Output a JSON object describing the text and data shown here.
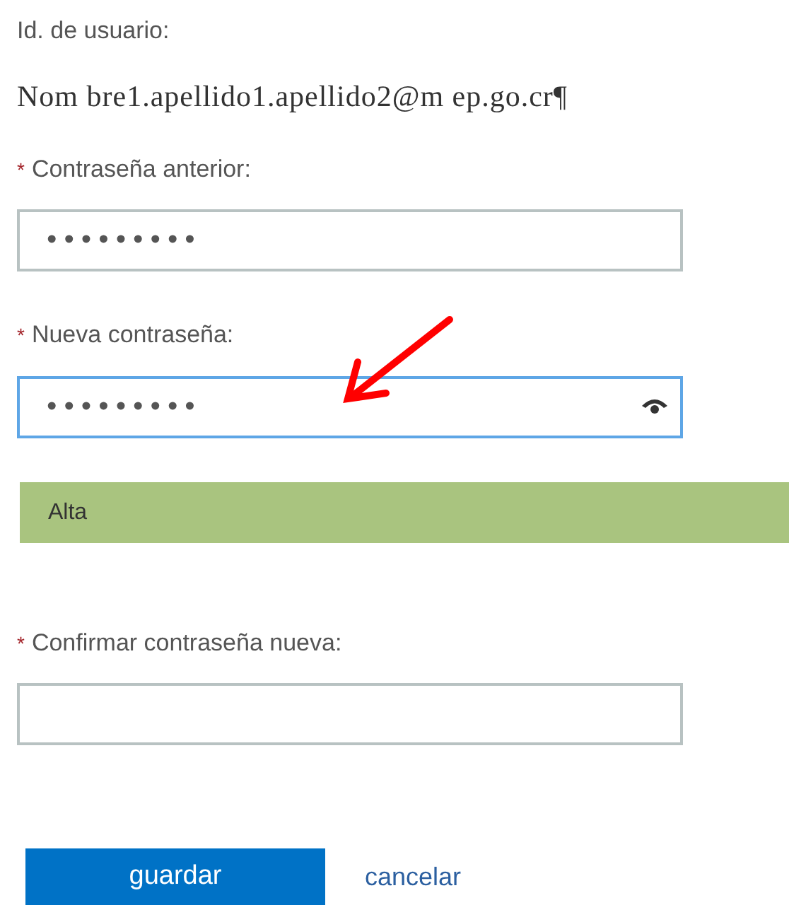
{
  "user_id": {
    "label": "Id. de usuario:",
    "value": "Nom bre1.apellido1.apellido2@m ep.go.cr¶"
  },
  "fields": [
    {
      "label": "Contraseña anterior:",
      "required": true,
      "value": "•••••••••",
      "focused": false,
      "reveal_toggle": false
    },
    {
      "label": "Nueva contraseña:",
      "required": true,
      "value": "•••••••••",
      "focused": true,
      "reveal_toggle": true
    },
    {
      "label": "Confirmar contraseña nueva:",
      "required": true,
      "focused": false,
      "reveal_toggle": false
    }
  ],
  "strength": {
    "label": "Alta"
  },
  "required_mark": "*",
  "buttons": {
    "save": "guardar",
    "cancel": "cancelar"
  }
}
